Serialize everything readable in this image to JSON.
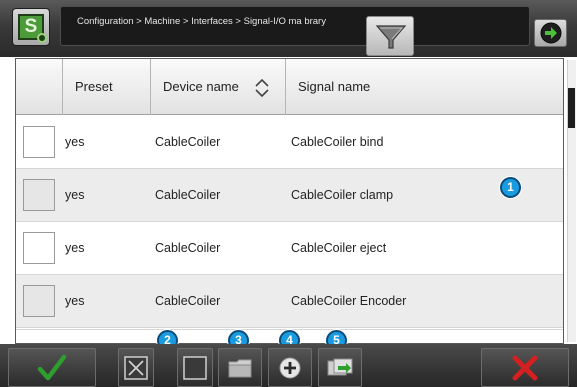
{
  "header": {
    "breadcrumb": "Configuration > Machine > Interfaces > Signal-I/O ma      brary"
  },
  "table": {
    "columns": [
      "Preset",
      "Device name",
      "Signal name"
    ],
    "sort_column": "Device name",
    "rows": [
      {
        "preset": "yes",
        "device": "CableCoiler",
        "signal": "CableCoiler bind"
      },
      {
        "preset": "yes",
        "device": "CableCoiler",
        "signal": "CableCoiler clamp"
      },
      {
        "preset": "yes",
        "device": "CableCoiler",
        "signal": "CableCoiler eject"
      },
      {
        "preset": "yes",
        "device": "CableCoiler",
        "signal": "CableCoiler Encoder"
      }
    ]
  },
  "markers": [
    "1",
    "2",
    "3",
    "4",
    "5"
  ],
  "colors": {
    "marker_fill": "#1a9be0",
    "confirm_green": "#2e9e2e",
    "cancel_red": "#d42020",
    "app_icon_green": "#4c9a3a"
  },
  "icons": {
    "app": "s5-app-icon",
    "filter": "funnel-icon",
    "next": "arrow-right-circle-icon",
    "sort": "sort-updown-icon",
    "confirm": "checkmark-icon",
    "deselect": "box-x-icon",
    "select": "empty-box-icon",
    "folder": "folder-icon",
    "add": "plus-circle-icon",
    "import": "import-arrow-icon",
    "cancel": "x-icon"
  }
}
